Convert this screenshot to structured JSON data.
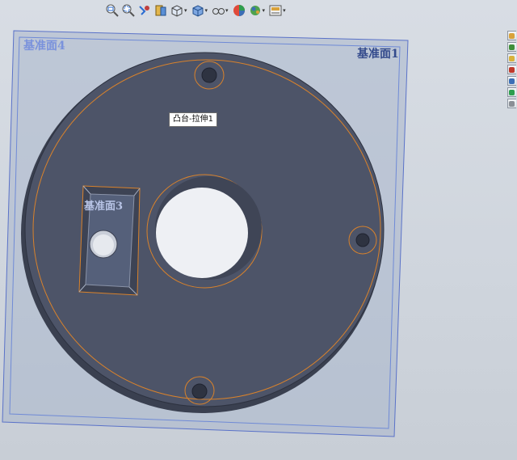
{
  "toolbar": {
    "buttons": [
      {
        "id": "zoom-to-fit",
        "icon": "zoom-fit-icon",
        "has_menu": false
      },
      {
        "id": "zoom-to-area",
        "icon": "zoom-area-icon",
        "has_menu": false
      },
      {
        "id": "previous-view",
        "icon": "previous-view-icon",
        "has_menu": false
      },
      {
        "id": "section-view",
        "icon": "section-view-icon",
        "has_menu": false
      },
      {
        "id": "view-orientation",
        "icon": "view-orientation-icon",
        "has_menu": true
      },
      {
        "id": "display-style",
        "icon": "display-style-icon",
        "has_menu": true
      },
      {
        "id": "hide-show-items",
        "icon": "hide-show-icon",
        "has_menu": true
      },
      {
        "id": "edit-appearance",
        "icon": "appearance-icon",
        "has_menu": false
      },
      {
        "id": "apply-scene",
        "icon": "scene-icon",
        "has_menu": true
      },
      {
        "id": "view-settings",
        "icon": "view-settings-icon",
        "has_menu": true
      }
    ]
  },
  "taskpane": {
    "tabs": [
      {
        "icon": "home-icon",
        "color": "#d9a23a"
      },
      {
        "icon": "resources-icon",
        "color": "#3f8f3a"
      },
      {
        "icon": "design-library-icon",
        "color": "#d8b23c"
      },
      {
        "icon": "file-explorer-icon",
        "color": "#c0392b"
      },
      {
        "icon": "view-palette-icon",
        "color": "#3b6fb6"
      },
      {
        "icon": "appearances-icon",
        "color": "#2e9e4f"
      },
      {
        "icon": "custom-properties-icon",
        "color": "#8a8f96"
      }
    ]
  },
  "viewport": {
    "planes": {
      "front": "基准面1",
      "top": "基准面3",
      "right": "基准面4"
    },
    "tooltip": "凸台-拉伸1"
  },
  "colors": {
    "part_face": "#4d5468",
    "part_side": "#3b4152",
    "plane_fill": "#aab6cc",
    "plane_edge": "#4f6fd0",
    "sketch": "#d9822b",
    "hole_inner": "#eaedf2"
  }
}
